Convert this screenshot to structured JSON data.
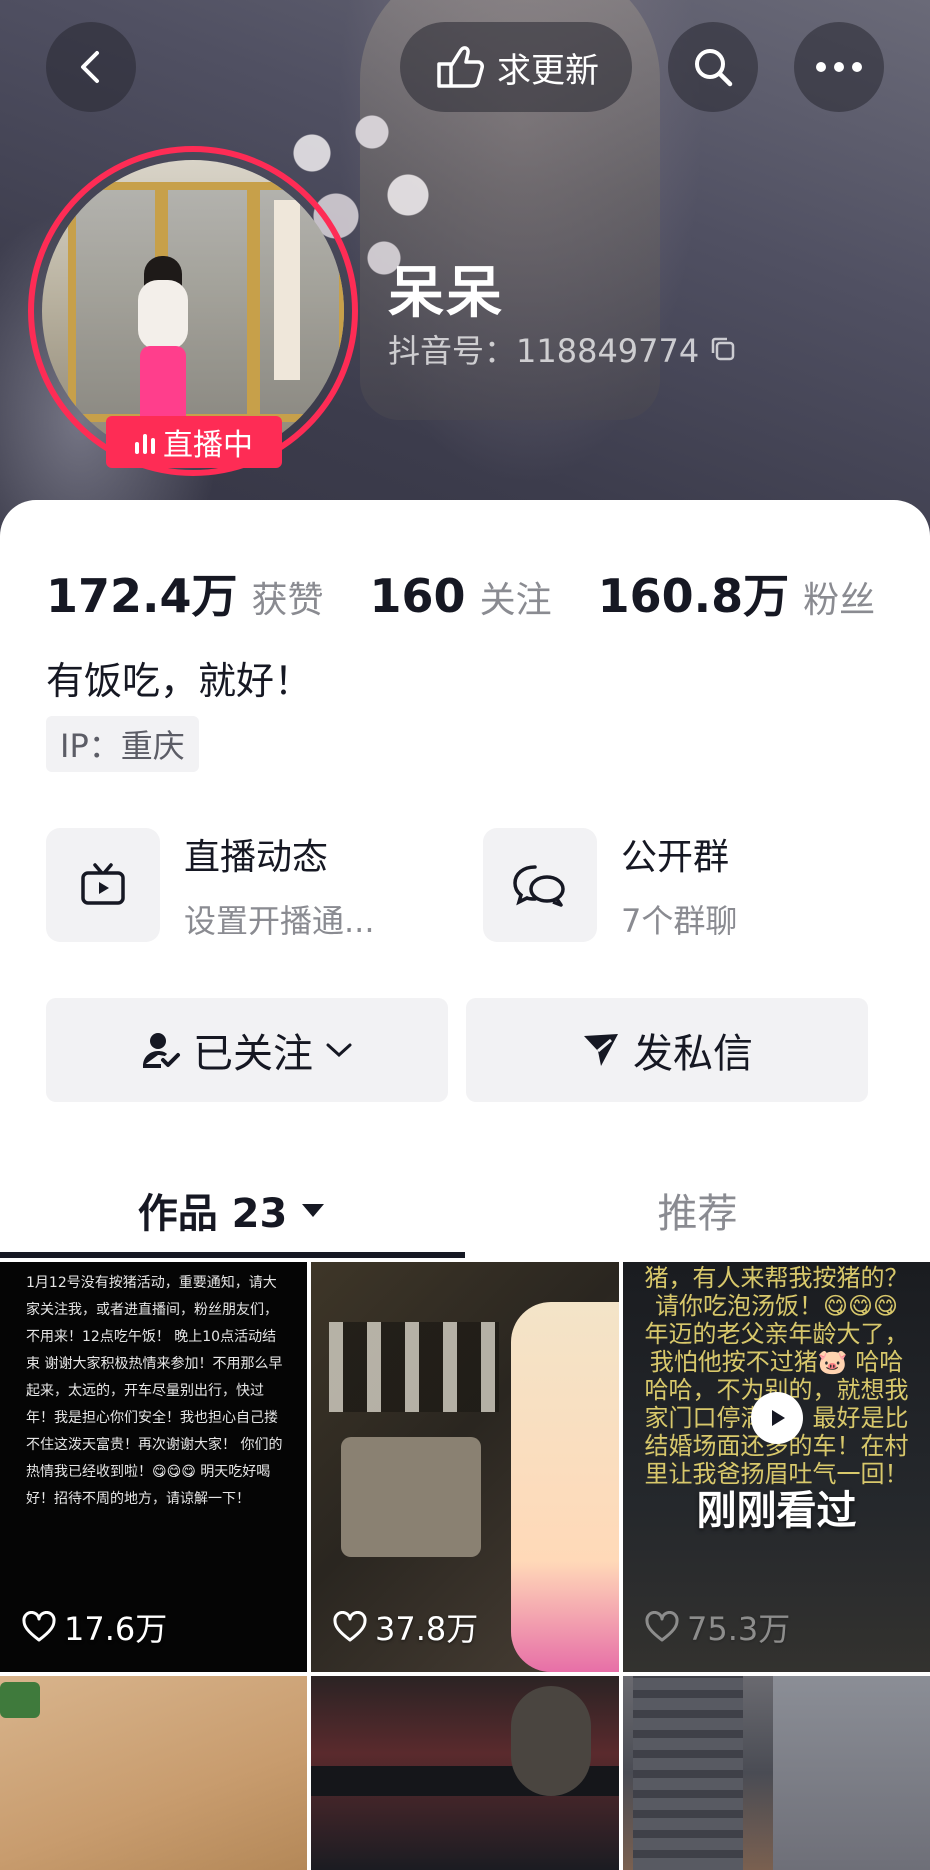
{
  "header": {
    "update_label": "求更新"
  },
  "profile": {
    "name": "呆呆",
    "account_id": "抖音号：118849774",
    "live_label": "直播中",
    "bio": "有饭吃，就好！",
    "ip": "IP：重庆"
  },
  "stats": [
    {
      "value": "172.4万",
      "label": "获赞"
    },
    {
      "value": "160",
      "label": "关注"
    },
    {
      "value": "160.8万",
      "label": "粉丝"
    }
  ],
  "features": {
    "live": {
      "title": "直播动态",
      "subtitle": "设置开播通..."
    },
    "group": {
      "title": "公开群",
      "subtitle": "7个群聊"
    }
  },
  "actions": {
    "follow_label": "已关注",
    "message_label": "发私信"
  },
  "tabs": {
    "works_label": "作品 23",
    "recommend_label": "推荐"
  },
  "grid": [
    {
      "likes": "17.6万",
      "caption": "1月12号没有按猪活动，重要通知，请大家关注我，或者进直播间，粉丝朋友们，不用来！12点吃午饭！ 晚上10点活动结束 谢谢大家积极热情来参加！不用那么早起来，太远的，开车尽量别出行，快过年！我是担心你们安全！我也担心自己搂不住这泼天富贵！再次谢谢大家！ 你们的热情我已经收到啦！😋😋😋 明天吃好喝好！招待不周的地方，请谅解一下！"
    },
    {
      "likes": "37.8万"
    },
    {
      "likes": "75.3万",
      "caption": "猪，有人来帮我按猪的？请你吃泡汤饭！😋😋😋 年迈的老父亲年龄大了，我怕他按不过猪🐷 哈哈哈哈，不为别的，就想我家门口停满车！最好是比结婚场面还多的车！在村里让我爸扬眉吐气一回！",
      "seen_label": "刚刚看过"
    }
  ],
  "colors": {
    "accent": "#fe2c55",
    "text_primary": "#161823",
    "text_secondary": "#8a8b91",
    "surface": "#f2f2f4"
  },
  "icons": [
    "back-icon",
    "thumb-icon",
    "search-icon",
    "more-icon",
    "copy-icon",
    "tv-icon",
    "chat-icon",
    "user-check-icon",
    "chevron-down-icon",
    "send-icon",
    "caret-down-icon",
    "heart-icon",
    "play-icon"
  ]
}
